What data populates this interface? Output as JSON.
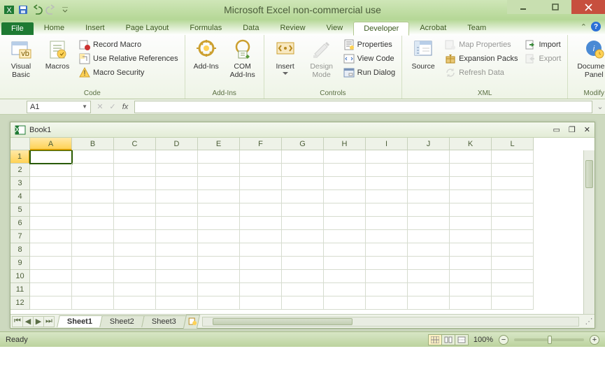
{
  "app_title": "Microsoft Excel non-commercial use",
  "tabs": {
    "file": "File",
    "items": [
      "Home",
      "Insert",
      "Page Layout",
      "Formulas",
      "Data",
      "Review",
      "View",
      "Developer",
      "Acrobat",
      "Team"
    ],
    "active": "Developer"
  },
  "ribbon": {
    "code": {
      "label": "Code",
      "visual_basic": "Visual\nBasic",
      "macros": "Macros",
      "record_macro": "Record Macro",
      "use_relative": "Use Relative References",
      "macro_security": "Macro Security"
    },
    "addins": {
      "label": "Add-Ins",
      "addins": "Add-Ins",
      "com_addins": "COM\nAdd-Ins"
    },
    "controls": {
      "label": "Controls",
      "insert": "Insert",
      "design_mode": "Design\nMode",
      "properties": "Properties",
      "view_code": "View Code",
      "run_dialog": "Run Dialog"
    },
    "xml": {
      "label": "XML",
      "source": "Source",
      "map_properties": "Map Properties",
      "expansion_packs": "Expansion Packs",
      "refresh_data": "Refresh Data",
      "import": "Import",
      "export": "Export"
    },
    "modify": {
      "label": "Modify",
      "document_panel": "Document\nPanel"
    }
  },
  "namebox": "A1",
  "workbook": {
    "title": "Book1",
    "columns": [
      "A",
      "B",
      "C",
      "D",
      "E",
      "F",
      "G",
      "H",
      "I",
      "J",
      "K",
      "L"
    ],
    "rows": [
      "1",
      "2",
      "3",
      "4",
      "5",
      "6",
      "7",
      "8",
      "9",
      "10",
      "11",
      "12"
    ],
    "active_cell": {
      "col": 0,
      "row": 0
    },
    "sheets": [
      "Sheet1",
      "Sheet2",
      "Sheet3"
    ],
    "active_sheet": "Sheet1"
  },
  "status": {
    "ready": "Ready",
    "zoom": "100%"
  }
}
